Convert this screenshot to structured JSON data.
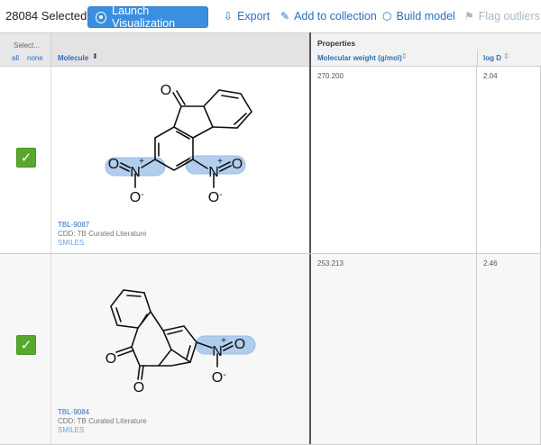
{
  "toolbar": {
    "selected_count": "28084 Selected:",
    "launch_label": "Launch Visualization",
    "export_label": "Export",
    "add_collection_label": "Add to collection",
    "build_model_label": "Build model",
    "flag_outliers_label": "Flag outliers"
  },
  "header": {
    "select_label": "Select...",
    "all_label": "all",
    "none_label": "none",
    "molecule_label": "Molecule",
    "properties_label": "Properties",
    "mw_label": "Molecular weight (g/mol)",
    "logd_label": "log D"
  },
  "rows": [
    {
      "selected": true,
      "id": "TBL-9087",
      "source": "CDD: TB Curated Literature",
      "smiles_link": "SMILES",
      "mw": "270.200",
      "logd": "2.04",
      "atom_labels": {
        "o_top": "O",
        "n1": "N",
        "o1": "O",
        "o1b": "O",
        "n2": "N",
        "o2": "O",
        "o2b": "O",
        "plus": "+",
        "minus": "-"
      }
    },
    {
      "selected": true,
      "id": "TBL-9084",
      "source": "CDD: TB Curated Literature",
      "smiles_link": "SMILES",
      "mw": "253.213",
      "logd": "2.46",
      "atom_labels": {
        "o_a": "O",
        "o_b": "O",
        "n1": "N",
        "o1": "O",
        "o1b": "O",
        "plus": "+",
        "minus": "-"
      }
    }
  ],
  "colors": {
    "accent": "#3b8fe0",
    "link": "#2a6fbd",
    "checkbox": "#57a82c",
    "highlight": "#a9c9ee"
  }
}
